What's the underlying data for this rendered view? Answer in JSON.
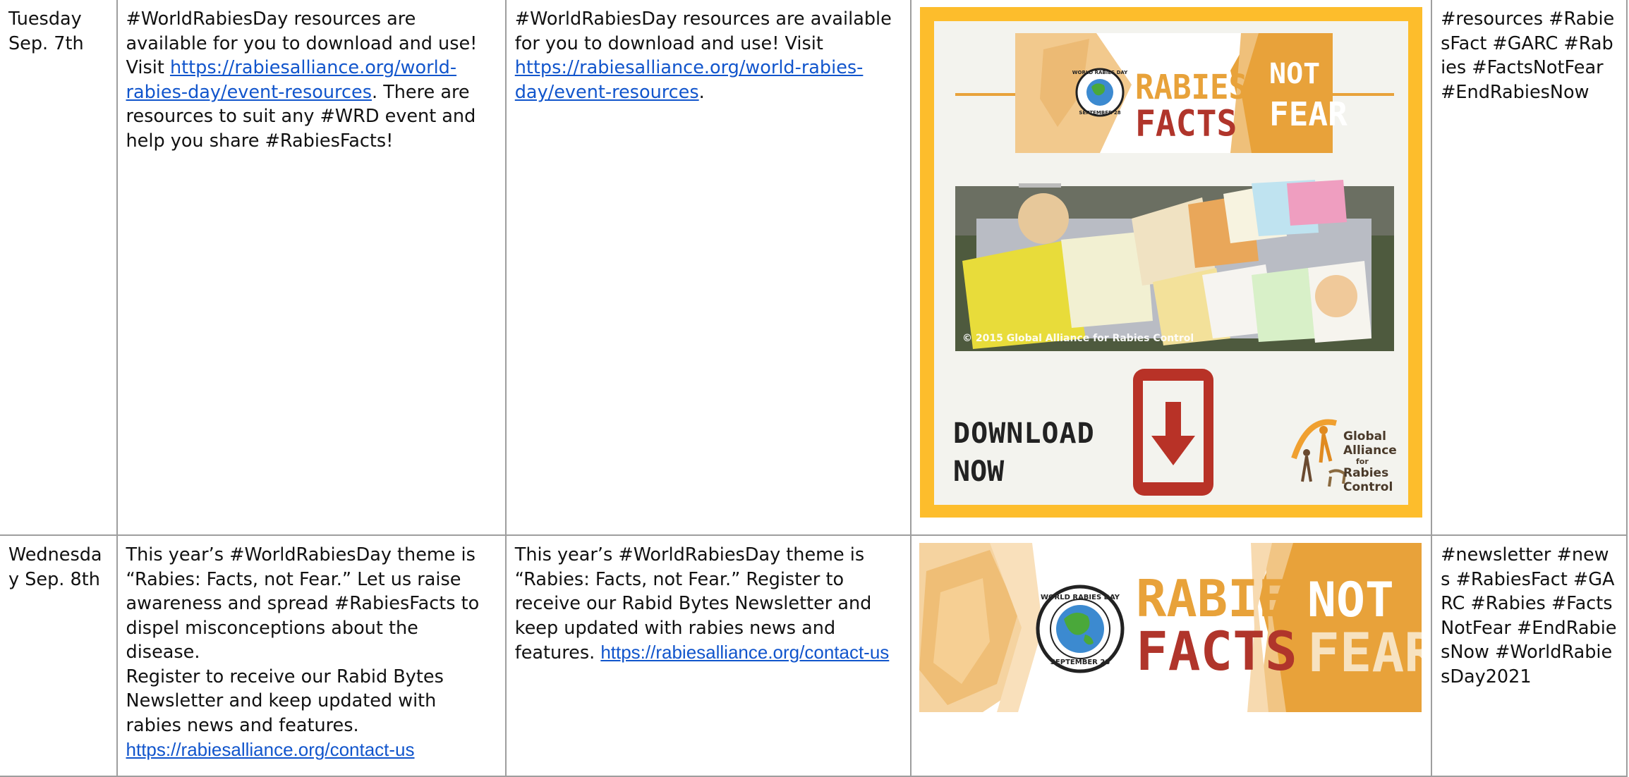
{
  "rows": [
    {
      "date": "Tuesday Sep. 7th",
      "post1_text": "#WorldRabiesDay resources are available for you to download and use! Visit ",
      "post1_link": "https://rabiesalliance.org/world-rabies-day/event-resources",
      "post1_after": ". There are resources to suit any #WRD event and help you share #RabiesFacts!",
      "post2_text": "#WorldRabiesDay resources are available for you to download and use! Visit ",
      "post2_link": "https://rabiesalliance.org/world-rabies-day/event-resources",
      "post2_after": ".",
      "hashtags": "#resources #RabiesFact #GARC #Rabies #FactsNotFear #EndRabiesNow",
      "graphic": {
        "rabies": "RABIES:",
        "facts": "FACTS",
        "not": "NOT",
        "fear": "FEAR",
        "copyright": "© 2015 Global Alliance for Rabies Control",
        "download_line1": "DOWNLOAD",
        "download_line2": "NOW",
        "garc_line1": "Global",
        "garc_line2": "Alliance",
        "garc_line3": "for",
        "garc_line4": "Rabies",
        "garc_line5": "Control",
        "seal_top": "WORLD RABIES DAY",
        "seal_bottom": "SEPTEMBER 28"
      }
    },
    {
      "date": "Wednesday Sep. 8th",
      "post1_text": "This year’s #WorldRabiesDay theme is “Rabies: Facts, not Fear.” Let us raise awareness and spread #RabiesFacts to dispel misconceptions about the disease.",
      "post1_text2": "Register to receive our Rabid Bytes Newsletter and keep updated with rabies news and features. ",
      "post1_link": "https://rabiesalliance.org/contact-us",
      "post2_text": "This year’s #WorldRabiesDay theme is “Rabies: Facts, not Fear.” Register to receive our Rabid Bytes Newsletter and keep updated with rabies news and features. ",
      "post2_link": "https://rabiesalliance.org/contact-us",
      "hashtags": "#newsletter #news #RabiesFact #GARC #Rabies #FactsNotFear #EndRabiesNow #WorldRabiesDay2021",
      "graphic": {
        "rabies": "RABIES:",
        "facts": "FACTS",
        "not": "NOT",
        "fear": "FEAR",
        "seal_top": "WORLD RABIES DAY",
        "seal_bottom": "SEPTEMBER 28"
      }
    }
  ],
  "colors": {
    "link": "#1155cc",
    "frame_yellow": "#fdbd2c",
    "rabies_orange": "#e8a23a",
    "facts_red": "#b0352b",
    "download_red": "#b83227"
  }
}
